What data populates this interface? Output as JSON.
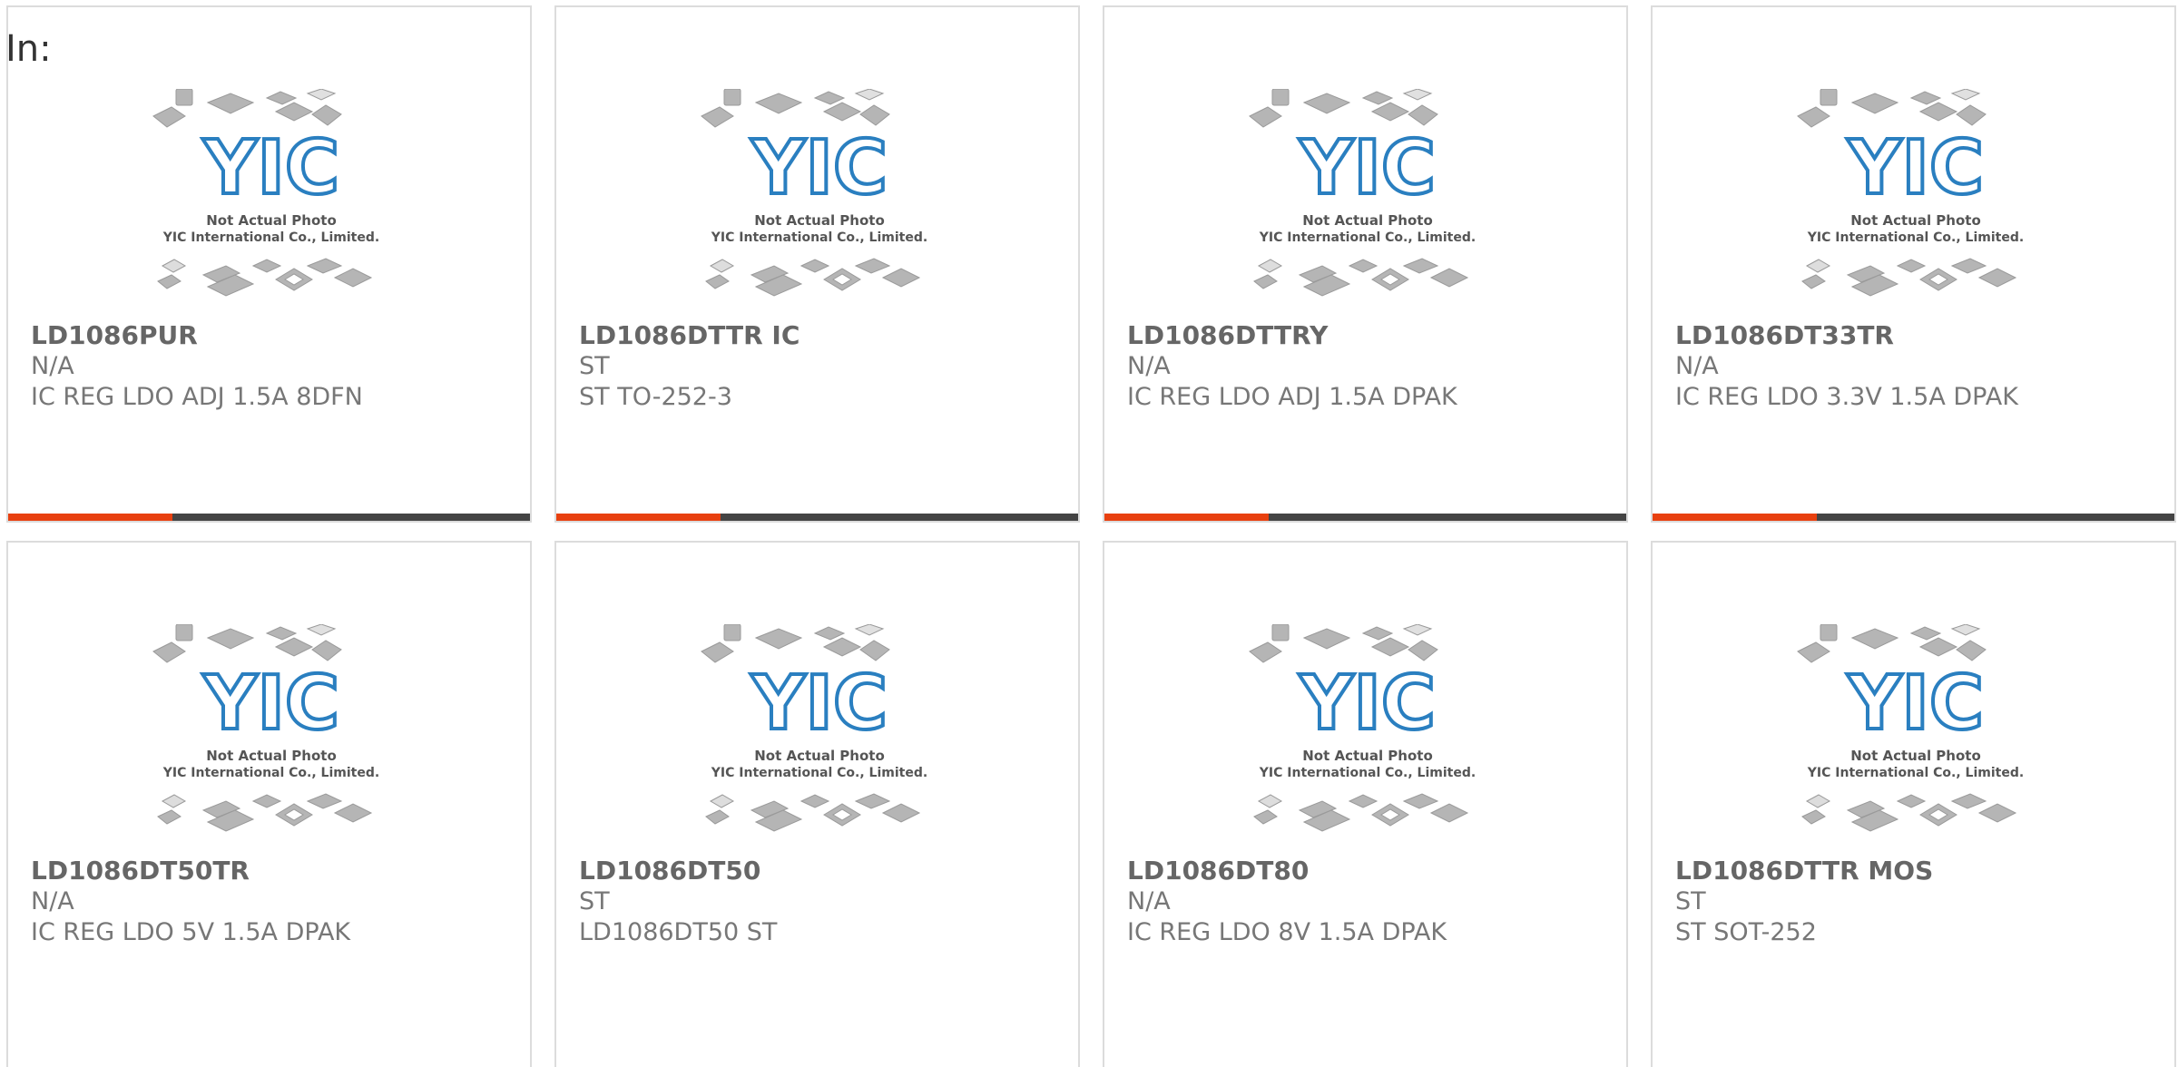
{
  "heading": "In:",
  "placeholder_image": {
    "line1": "Not Actual Photo",
    "line2": "YIC International Co., Limited.",
    "logo_text": "YIC"
  },
  "colors": {
    "accent": "#e8400f",
    "bar": "#444444",
    "logo_blue": "#2a7fc0"
  },
  "products": [
    {
      "part": "LD1086PUR",
      "manufacturer": "N/A",
      "description": "IC REG LDO ADJ 1.5A 8DFN"
    },
    {
      "part": "LD1086DTTR IC",
      "manufacturer": "ST",
      "description": "ST TO-252-3"
    },
    {
      "part": "LD1086DTTRY",
      "manufacturer": "N/A",
      "description": "IC REG LDO ADJ 1.5A DPAK"
    },
    {
      "part": "LD1086DT33TR",
      "manufacturer": "N/A",
      "description": "IC REG LDO 3.3V 1.5A DPAK"
    },
    {
      "part": "LD1086DT50TR",
      "manufacturer": "N/A",
      "description": "IC REG LDO 5V 1.5A DPAK"
    },
    {
      "part": "LD1086DT50",
      "manufacturer": "ST",
      "description": "LD1086DT50 ST"
    },
    {
      "part": "LD1086DT80",
      "manufacturer": "N/A",
      "description": "IC REG LDO 8V 1.5A DPAK"
    },
    {
      "part": "LD1086DTTR MOS",
      "manufacturer": "ST",
      "description": "ST SOT-252"
    }
  ]
}
